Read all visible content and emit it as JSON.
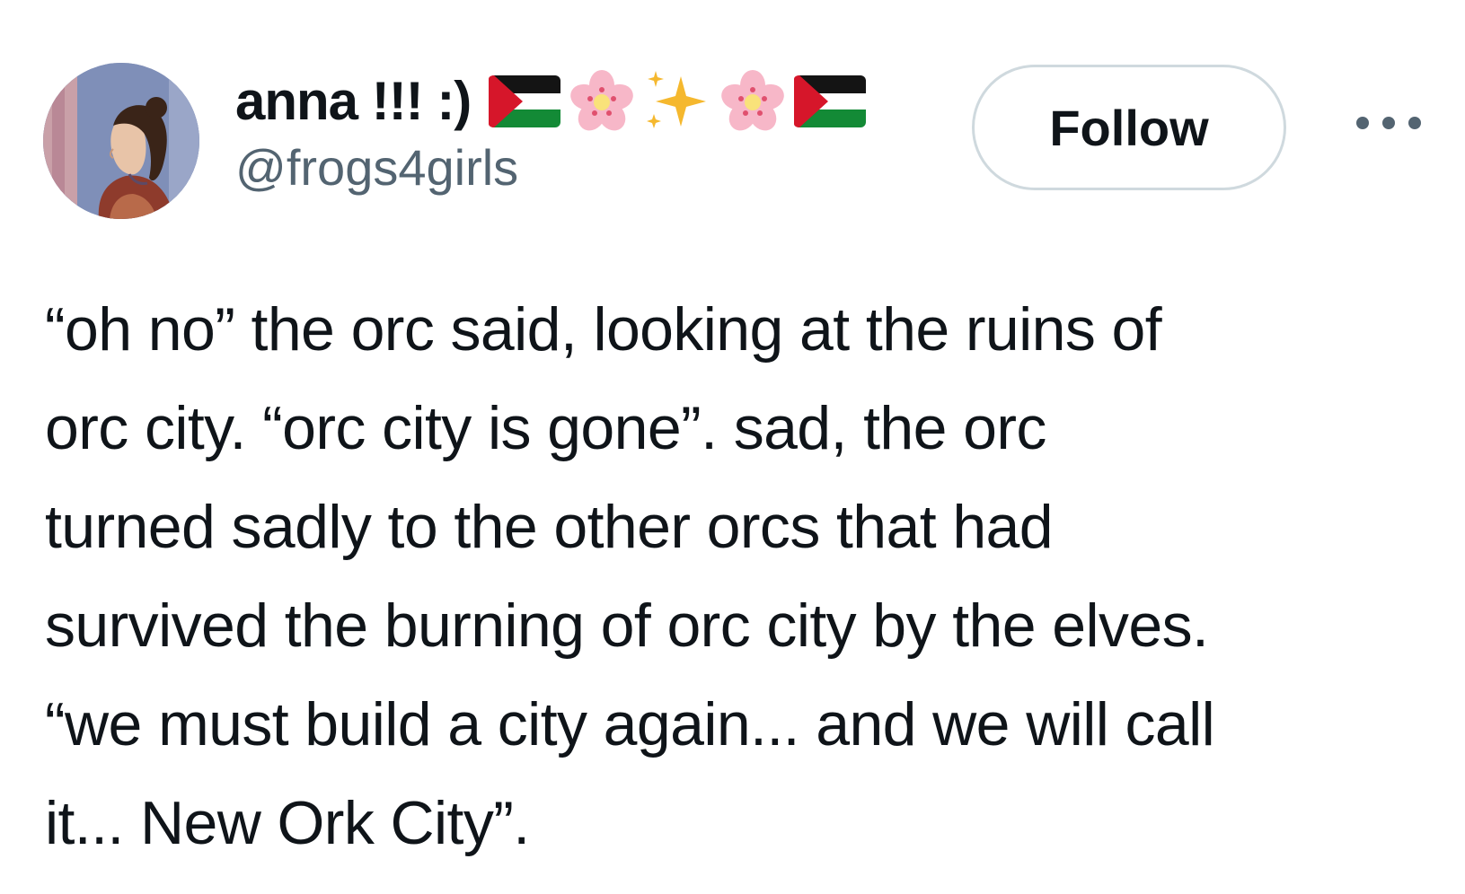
{
  "author": {
    "display_name": "anna !!! :)",
    "handle": "@frogs4girls",
    "name_emojis": [
      "palestine-flag",
      "cherry-blossom",
      "sparkles",
      "cherry-blossom",
      "palestine-flag"
    ]
  },
  "actions": {
    "follow_label": "Follow",
    "more_icon": "more-horizontal-icon"
  },
  "tweet": {
    "lines": [
      "“oh no” the orc said, looking at the ruins of",
      "orc city. “orc city is gone”. sad, the orc",
      "turned sadly to the other orcs that had",
      "survived the burning of orc city by the elves.",
      "“we must build a city again... and we will call",
      "it... New Ork City”."
    ]
  },
  "colors": {
    "text": "#0f1419",
    "secondary_text": "#536471",
    "button_border": "#cfd9de"
  }
}
